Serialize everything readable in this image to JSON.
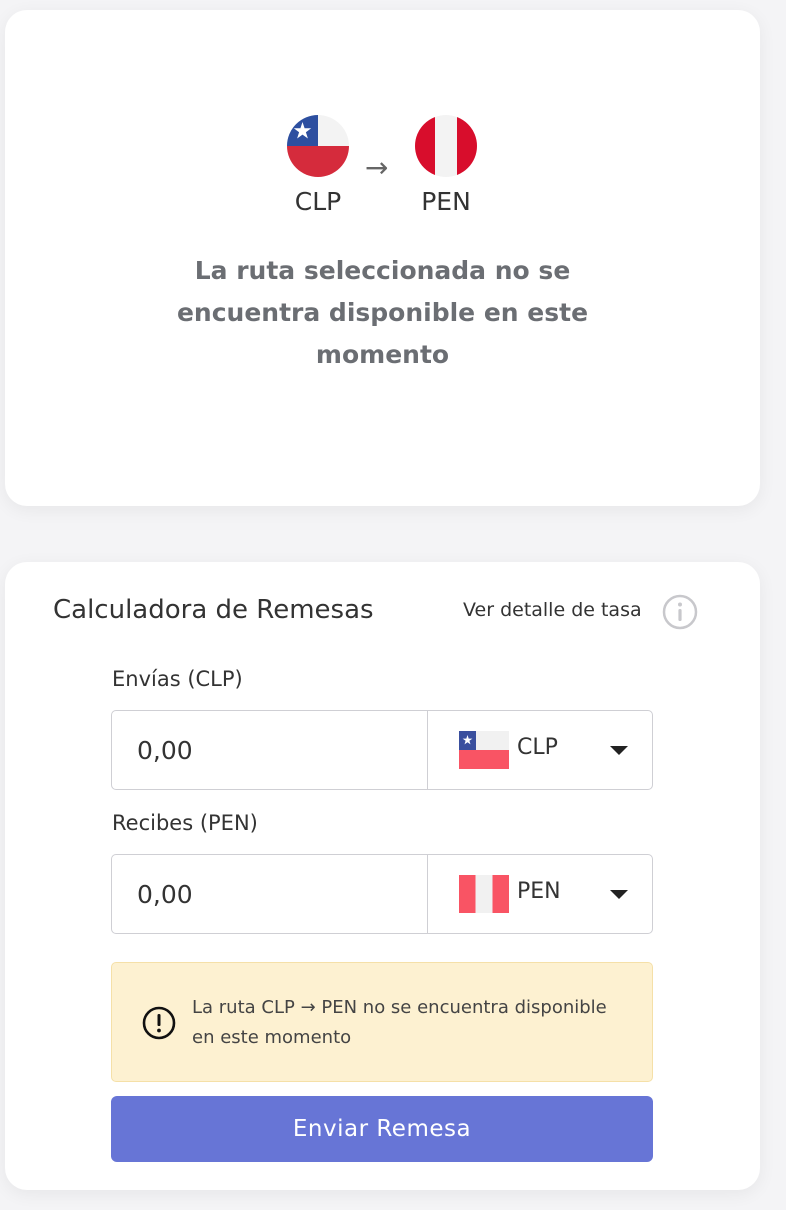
{
  "route_card": {
    "from_code": "CLP",
    "to_code": "PEN",
    "arrow": "→",
    "message": "La ruta seleccionada no se encuentra disponible en este momento"
  },
  "calculator": {
    "title": "Calculadora de Remesas",
    "rate_link": "Ver detalle de tasa",
    "info_icon": "info-circle-icon",
    "send": {
      "label": "Envías (CLP)",
      "amount": "0,00",
      "currency": "CLP",
      "flag_icon": "chile-flag-icon"
    },
    "receive": {
      "label": "Recibes (PEN)",
      "amount": "0,00",
      "currency": "PEN",
      "flag_icon": "peru-flag-icon"
    },
    "warning": {
      "icon": "exclamation-circle-icon",
      "text": "La ruta CLP → PEN no se encuentra disponible en este momento"
    },
    "submit_label": "Enviar Remesa"
  },
  "colors": {
    "accent": "#6775d6",
    "warning_bg": "#fdf1d1",
    "muted_text": "#6b6e73",
    "flag_red": "#d52b3c",
    "flag_blue": "#2d4fa0"
  }
}
